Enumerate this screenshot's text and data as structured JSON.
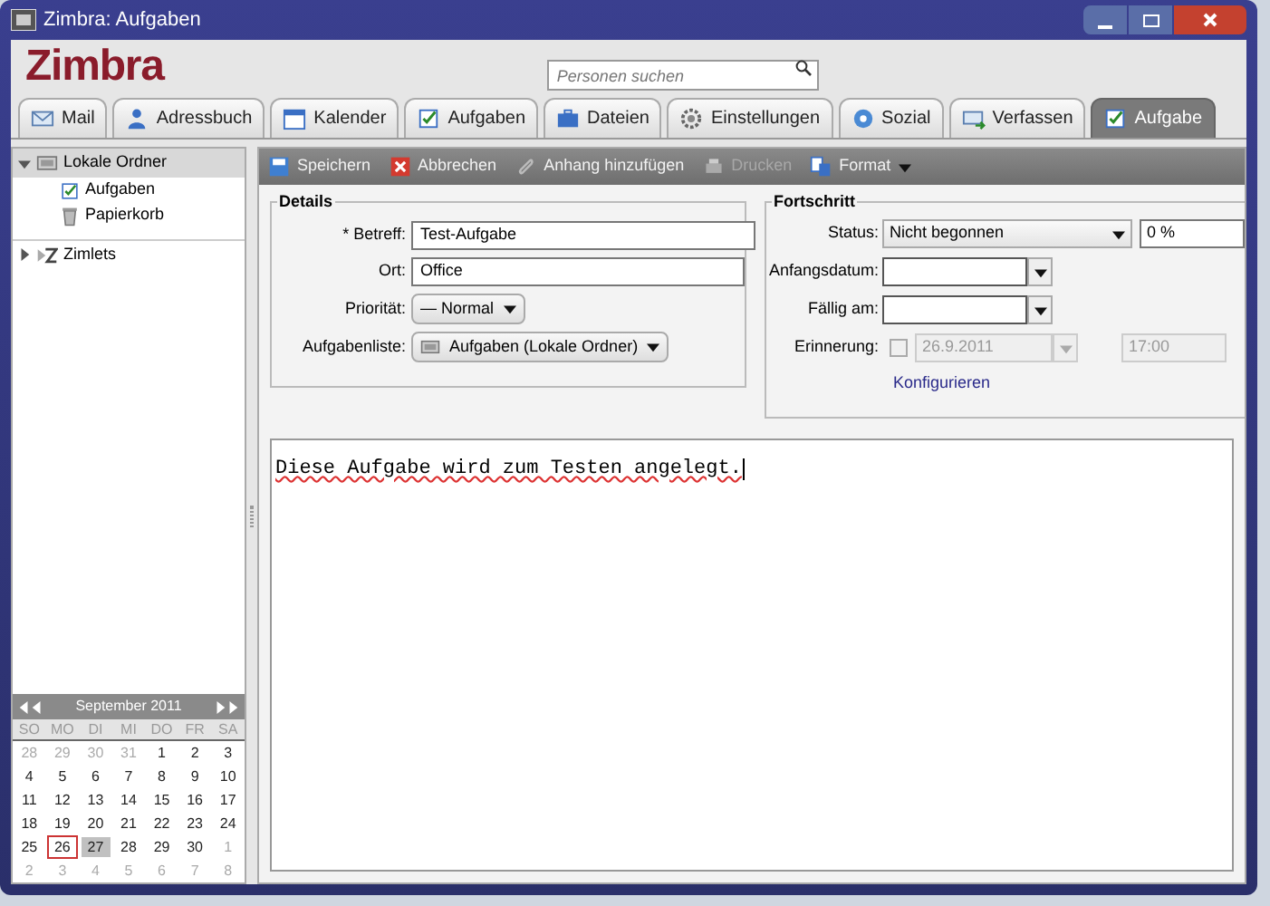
{
  "window": {
    "title": "Zimbra: Aufgaben"
  },
  "logo": "Zimbra",
  "search": {
    "placeholder": "Personen suchen"
  },
  "tabs": [
    {
      "label": "Mail",
      "kind": "mail",
      "selected": false
    },
    {
      "label": "Adressbuch",
      "kind": "contact",
      "selected": false
    },
    {
      "label": "Kalender",
      "kind": "calendar",
      "selected": false
    },
    {
      "label": "Aufgaben",
      "kind": "task",
      "selected": false
    },
    {
      "label": "Dateien",
      "kind": "briefcase",
      "selected": false
    },
    {
      "label": "Einstellungen",
      "kind": "gear",
      "selected": false
    },
    {
      "label": "Sozial",
      "kind": "social",
      "selected": false
    },
    {
      "label": "Verfassen",
      "kind": "compose",
      "selected": false
    },
    {
      "label": "Aufgabe",
      "kind": "task",
      "selected": true
    }
  ],
  "sidebar": {
    "items": [
      {
        "label": "Lokale Ordner",
        "kind": "folder",
        "expanded": true,
        "children": [
          {
            "label": "Aufgaben",
            "kind": "task"
          },
          {
            "label": "Papierkorb",
            "kind": "trash"
          }
        ]
      },
      {
        "label": "Zimlets",
        "kind": "zimlet",
        "expanded": false
      }
    ]
  },
  "toolbar": [
    {
      "label": "Speichern",
      "kind": "save",
      "disabled": false
    },
    {
      "label": "Abbrechen",
      "kind": "cancel",
      "disabled": false
    },
    {
      "label": "Anhang hinzufügen",
      "kind": "clip",
      "disabled": false
    },
    {
      "label": "Drucken",
      "kind": "print",
      "disabled": true
    },
    {
      "label": "Format",
      "kind": "format",
      "disabled": false,
      "menu": true
    }
  ],
  "details": {
    "title": "Details",
    "fields": [
      {
        "label": "* Betreff:",
        "value": "Test-Aufgabe",
        "kind": "text"
      },
      {
        "label": "Ort:",
        "value": "Office",
        "kind": "text"
      },
      {
        "label": "Priorität:",
        "value": "— Normal",
        "kind": "select"
      },
      {
        "label": "Aufgabenliste:",
        "value": "Aufgaben (Lokale Ordner)",
        "kind": "folder-select"
      }
    ]
  },
  "progress": {
    "title": "Fortschritt",
    "status": {
      "label": "Status:",
      "value": "Nicht begonnen"
    },
    "percent": "0 %",
    "start": {
      "label": "Anfangsdatum:"
    },
    "due": {
      "label": "Fällig am:"
    },
    "reminder": {
      "label": "Erinnerung:",
      "checked": false,
      "disabled": true,
      "date": "26.9.2011",
      "time": "17:00"
    },
    "configure": "Konfigurieren"
  },
  "body": "Diese Aufgabe wird zum Testen angelegt.",
  "calendar": {
    "month": "September 2011",
    "weekdays": [
      "SO",
      "MO",
      "DI",
      "MI",
      "DO",
      "FR",
      "SA"
    ],
    "weeks": [
      [
        {
          "day": "28",
          "kind": "other"
        },
        {
          "day": "29",
          "kind": "other"
        },
        {
          "day": "30",
          "kind": "other"
        },
        {
          "day": "31",
          "kind": "other"
        },
        {
          "day": "1",
          "kind": "day"
        },
        {
          "day": "2",
          "kind": "day"
        },
        {
          "day": "3",
          "kind": "day"
        }
      ],
      [
        {
          "day": "4",
          "kind": "day"
        },
        {
          "day": "5",
          "kind": "day"
        },
        {
          "day": "6",
          "kind": "day"
        },
        {
          "day": "7",
          "kind": "day"
        },
        {
          "day": "8",
          "kind": "day"
        },
        {
          "day": "9",
          "kind": "day"
        },
        {
          "day": "10",
          "kind": "day"
        }
      ],
      [
        {
          "day": "11",
          "kind": "day"
        },
        {
          "day": "12",
          "kind": "day"
        },
        {
          "day": "13",
          "kind": "day"
        },
        {
          "day": "14",
          "kind": "day"
        },
        {
          "day": "15",
          "kind": "day"
        },
        {
          "day": "16",
          "kind": "day"
        },
        {
          "day": "17",
          "kind": "day"
        }
      ],
      [
        {
          "day": "18",
          "kind": "day"
        },
        {
          "day": "19",
          "kind": "day"
        },
        {
          "day": "20",
          "kind": "day"
        },
        {
          "day": "21",
          "kind": "day"
        },
        {
          "day": "22",
          "kind": "day"
        },
        {
          "day": "23",
          "kind": "day"
        },
        {
          "day": "24",
          "kind": "day"
        }
      ],
      [
        {
          "day": "25",
          "kind": "day"
        },
        {
          "day": "26",
          "kind": "today"
        },
        {
          "day": "27",
          "kind": "selected"
        },
        {
          "day": "28",
          "kind": "day"
        },
        {
          "day": "29",
          "kind": "day"
        },
        {
          "day": "30",
          "kind": "day"
        },
        {
          "day": "1",
          "kind": "other"
        }
      ],
      [
        {
          "day": "2",
          "kind": "other"
        },
        {
          "day": "3",
          "kind": "other"
        },
        {
          "day": "4",
          "kind": "other"
        },
        {
          "day": "5",
          "kind": "other"
        },
        {
          "day": "6",
          "kind": "other"
        },
        {
          "day": "7",
          "kind": "other"
        },
        {
          "day": "8",
          "kind": "other"
        }
      ]
    ]
  }
}
